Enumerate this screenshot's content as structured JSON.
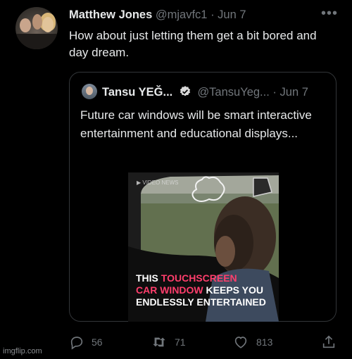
{
  "tweet": {
    "display_name": "Matthew Jones",
    "handle": "@mjavfc1",
    "separator": "·",
    "date": "Jun 7",
    "text": "How about just letting them get a bit bored and day dream.",
    "more_icon": "more-horizontal-icon"
  },
  "quoted": {
    "display_name": "Tansu YEĞ...",
    "handle": "@TansuYeg...",
    "separator": "·",
    "date": "Jun 7",
    "verified_icon": "verified-badge-icon",
    "text": "Future car windows will be smart interactive entertainment and educational displays...",
    "video": {
      "watermark": "▶ VIDEO NEWS",
      "caption_line1_a": "THIS ",
      "caption_line1_b": "TOUCHSCREEN",
      "caption_line2_a": "CAR WINDOW",
      "caption_line2_b": " KEEPS YOU",
      "caption_line3": "ENDLESSLY ENTERTAINED",
      "accent_color": "#ff3e6c"
    }
  },
  "actions": {
    "replies": "56",
    "retweets": "71",
    "likes": "813"
  },
  "footer": {
    "watermark": "imgflip.com"
  }
}
